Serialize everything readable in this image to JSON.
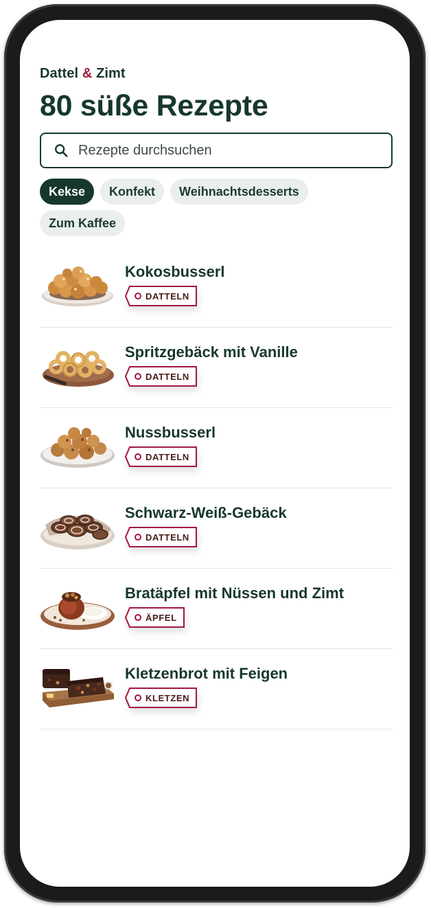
{
  "brand": {
    "part1": "Dattel",
    "amp": "&",
    "part2": "Zimt"
  },
  "title": "80 süße Rezepte",
  "search": {
    "placeholder": "Rezepte durchsuchen"
  },
  "chips": [
    "Kekse",
    "Konfekt",
    "Weihnachtsdesserts",
    "Zum Kaffee"
  ],
  "active_chip": "Kekse",
  "recipes": [
    {
      "name": "Kokosbusserl",
      "tag": "DATTELN",
      "image": "coconut-macaroons"
    },
    {
      "name": "Spritzgebäck mit Vanille",
      "tag": "DATTELN",
      "image": "spritz-cookies"
    },
    {
      "name": "Nussbusserl",
      "tag": "DATTELN",
      "image": "nut-macaroons"
    },
    {
      "name": "Schwarz-Weiß-Gebäck",
      "tag": "DATTELN",
      "image": "pinwheel-cookies"
    },
    {
      "name": "Bratäpfel mit Nüssen und Zimt",
      "tag": "ÄPFEL",
      "image": "baked-apple"
    },
    {
      "name": "Kletzenbrot mit Feigen",
      "tag": "KLETZEN",
      "image": "fruit-bread"
    }
  ],
  "colors": {
    "primary": "#16382b",
    "accent": "#a0183c",
    "chip_bg": "#eaefec"
  }
}
